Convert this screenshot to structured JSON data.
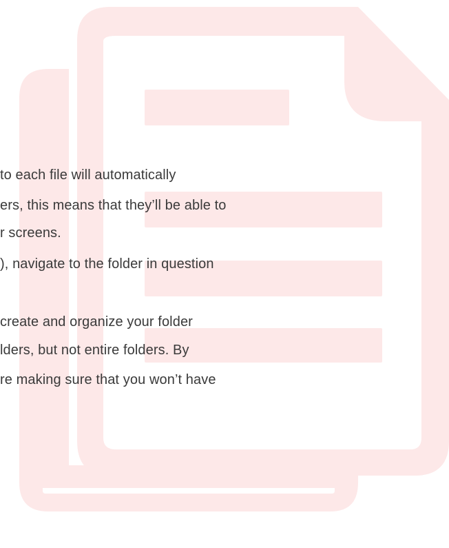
{
  "body": {
    "lines": [
      "to each file will automatically",
      "ers, this means that they’ll be able to",
      "r screens.",
      "), navigate to the folder in question",
      "create and organize your folder",
      "lders, but not entire folders. By",
      "re making sure that you won’t have"
    ]
  },
  "watermark": {
    "icon": "document-copy-icon",
    "color": "#fde8e8"
  }
}
